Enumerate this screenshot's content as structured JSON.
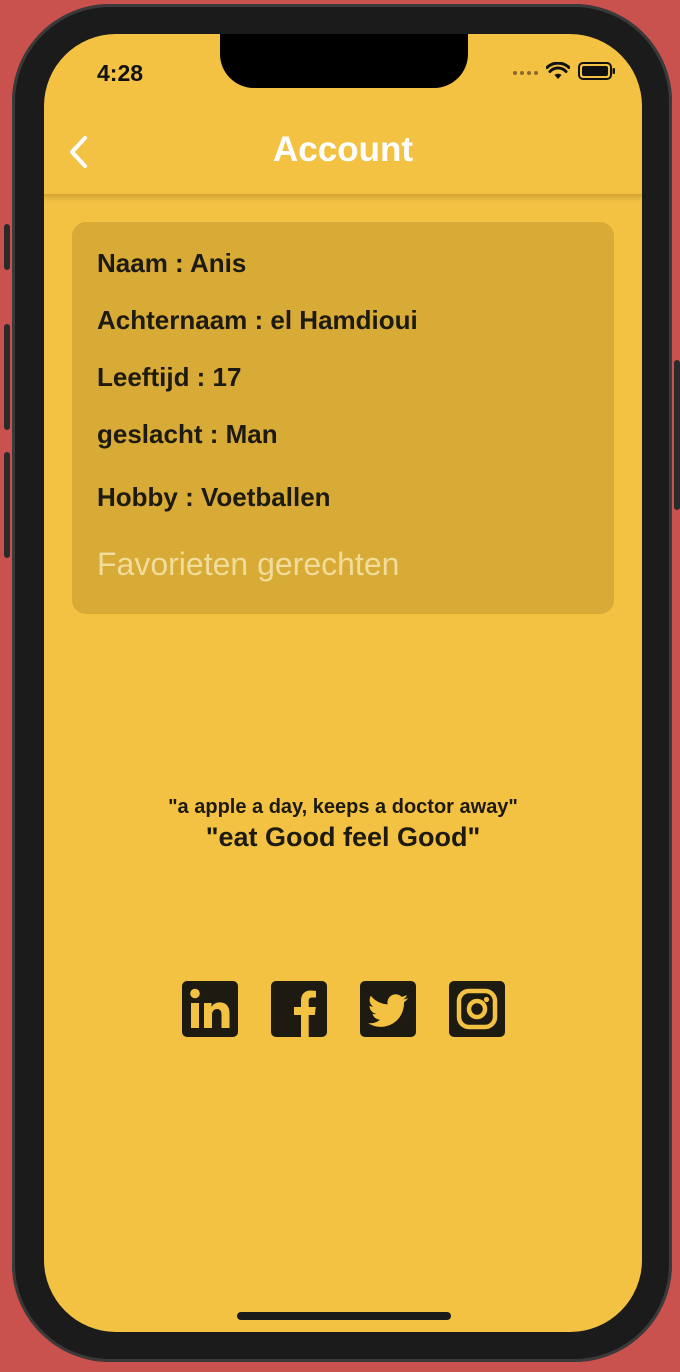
{
  "status_bar": {
    "time": "4:28",
    "icons": [
      "signal-icon",
      "wifi-icon",
      "battery-icon"
    ]
  },
  "header": {
    "back_icon": "chevron-left-icon",
    "title": "Account"
  },
  "profile": {
    "naam": "Naam : Anis",
    "achternaam": "Achternaam : el Hamdioui",
    "leeftijd": "Leeftijd : 17",
    "geslacht": "geslacht : Man",
    "hobby": "Hobby : Voetballen",
    "favorites_link": "Favorieten gerechten"
  },
  "quotes": {
    "small": "\"a apple a day, keeps a doctor away\"",
    "big": "\"eat Good feel Good\""
  },
  "social": [
    "linkedin-icon",
    "facebook-icon",
    "twitter-icon",
    "instagram-icon"
  ],
  "colors": {
    "background": "#f4c242",
    "card": "#d8aa36",
    "text": "#1d1a12",
    "header_text": "#ffffff",
    "link": "#f1dc9a"
  }
}
